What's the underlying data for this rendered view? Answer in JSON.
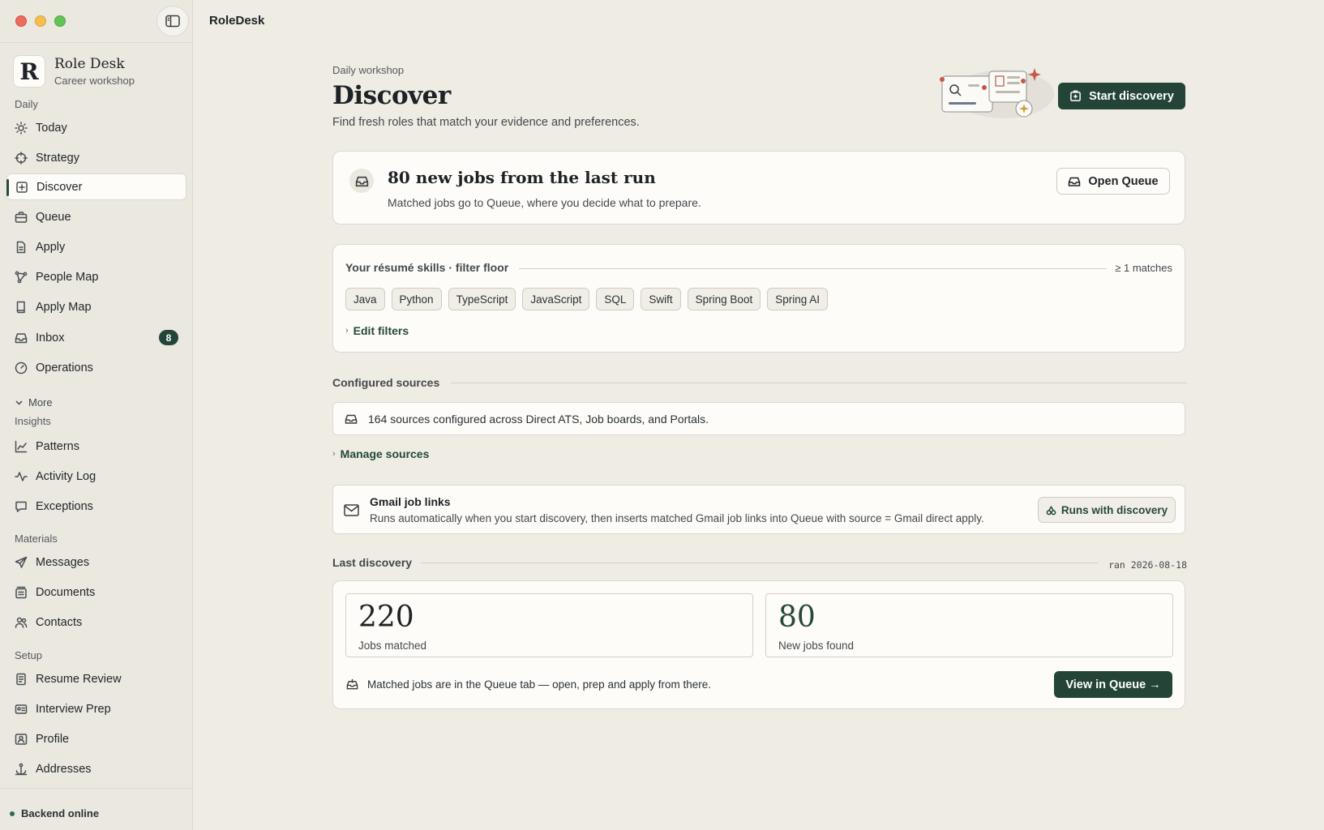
{
  "app": {
    "title": "RoleDesk"
  },
  "brand": {
    "logo_letter": "R",
    "name": "Role Desk",
    "subtitle": "Career workshop"
  },
  "sidebar": {
    "sections": {
      "daily": "Daily",
      "insights": "Insights",
      "materials": "Materials",
      "setup": "Setup"
    },
    "more_label": "More",
    "items": [
      {
        "label": "Today",
        "icon": "sun-icon"
      },
      {
        "label": "Strategy",
        "icon": "crosshair-icon"
      },
      {
        "label": "Discover",
        "icon": "discover-icon",
        "active": true
      },
      {
        "label": "Queue",
        "icon": "briefcase-icon"
      },
      {
        "label": "Apply",
        "icon": "document-icon"
      },
      {
        "label": "People Map",
        "icon": "network-icon"
      },
      {
        "label": "Apply Map",
        "icon": "book-icon"
      },
      {
        "label": "Inbox",
        "icon": "inbox-icon",
        "badge": "8"
      },
      {
        "label": "Operations",
        "icon": "gauge-icon"
      },
      {
        "label": "Patterns",
        "icon": "chart-icon"
      },
      {
        "label": "Activity Log",
        "icon": "activity-icon"
      },
      {
        "label": "Exceptions",
        "icon": "message-icon"
      },
      {
        "label": "Messages",
        "icon": "send-icon"
      },
      {
        "label": "Documents",
        "icon": "stack-icon"
      },
      {
        "label": "Contacts",
        "icon": "people-icon"
      },
      {
        "label": "Resume Review",
        "icon": "resume-icon"
      },
      {
        "label": "Interview Prep",
        "icon": "card-icon"
      },
      {
        "label": "Profile",
        "icon": "profile-icon"
      },
      {
        "label": "Addresses",
        "icon": "anchor-icon"
      }
    ],
    "status": "Backend online"
  },
  "header": {
    "eyebrow": "Daily workshop",
    "title": "Discover",
    "subtitle": "Find fresh roles that match your evidence and preferences.",
    "start_button": "Start discovery"
  },
  "run_card": {
    "title": "80 new jobs from the last run",
    "subtitle": "Matched jobs go to Queue, where you decide what to prepare.",
    "button": "Open Queue"
  },
  "skills": {
    "heading": "Your résumé skills · filter floor",
    "matches": "≥ 1 matches",
    "chips": [
      "Java",
      "Python",
      "TypeScript",
      "JavaScript",
      "SQL",
      "Swift",
      "Spring Boot",
      "Spring AI"
    ],
    "edit_label": "Edit filters"
  },
  "sources": {
    "heading": "Configured sources",
    "text": "164 sources configured across Direct ATS, Job boards, and Portals.",
    "manage_label": "Manage sources"
  },
  "gmail": {
    "title": "Gmail job links",
    "subtitle": "Runs automatically when you start discovery, then inserts matched Gmail job links into Queue with source = Gmail direct apply.",
    "button": "Runs with discovery"
  },
  "last_discovery": {
    "heading": "Last discovery",
    "ran": "ran 2026-08-18",
    "stats": [
      {
        "value": "220",
        "label": "Jobs matched"
      },
      {
        "value": "80",
        "label": "New jobs found"
      }
    ],
    "footer": "Matched jobs are in the Queue tab — open, prep and apply from there.",
    "button": "View in Queue →"
  }
}
